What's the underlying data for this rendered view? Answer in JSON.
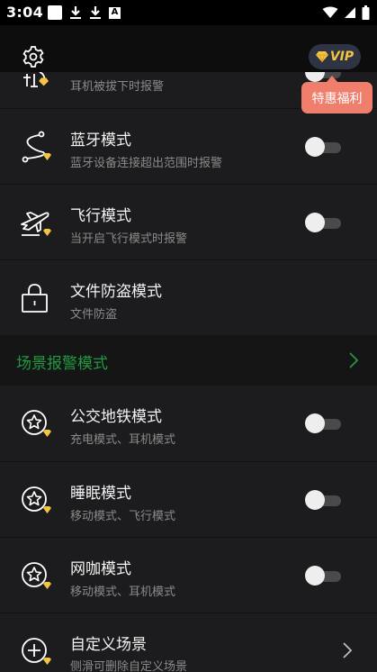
{
  "status_bar": {
    "time": "3:04",
    "notification_letter": "A"
  },
  "header": {
    "vip_label": "VIP",
    "promo_label": "特惠福利"
  },
  "rows": [
    {
      "subtitle": "耳机被拔下时报警"
    },
    {
      "title": "蓝牙模式",
      "subtitle": "蓝牙设备连接超出范围时报警",
      "toggle_on": false
    },
    {
      "title": "飞行模式",
      "subtitle": "当开启飞行模式时报警",
      "toggle_on": false
    },
    {
      "title": "文件防盗模式",
      "subtitle": "文件防盗"
    }
  ],
  "section": {
    "label": "场景报警模式"
  },
  "scene_rows": [
    {
      "title": "公交地铁模式",
      "subtitle": "充电模式、耳机模式",
      "toggle_on": false
    },
    {
      "title": "睡眠模式",
      "subtitle": "移动模式、飞行模式",
      "toggle_on": false
    },
    {
      "title": "网咖模式",
      "subtitle": "移动模式、耳机模式",
      "toggle_on": false
    },
    {
      "title": "自定义场景",
      "subtitle": "侧滑可删除自定义场景"
    }
  ],
  "colors": {
    "accent_green": "#1f9a42",
    "vip_gold": "#f5c542",
    "promo_bg": "#ef7e6d"
  }
}
